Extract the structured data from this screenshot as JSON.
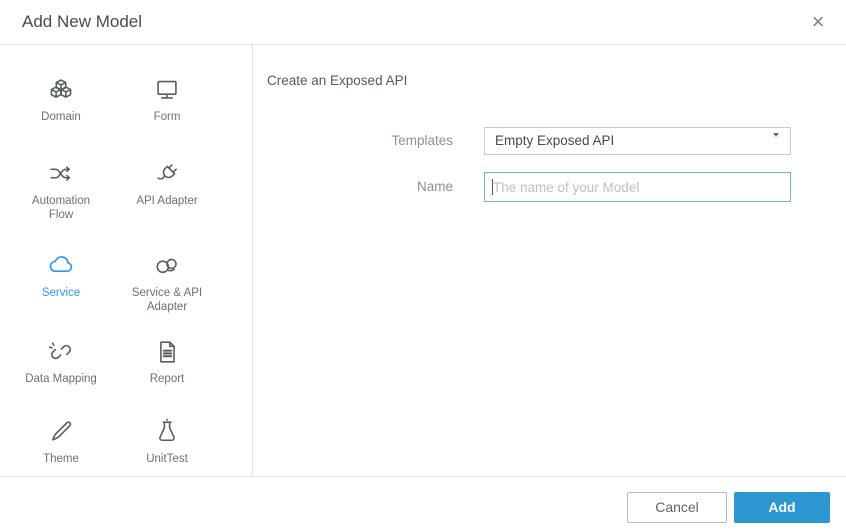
{
  "dialog": {
    "title": "Add New Model",
    "close_glyph": "×"
  },
  "sidebar": {
    "items": [
      {
        "label": "Domain",
        "icon": "cubes-icon",
        "selected": false
      },
      {
        "label": "Form",
        "icon": "monitor-icon",
        "selected": false
      },
      {
        "label": "Automation Flow",
        "icon": "shuffle-icon",
        "selected": false
      },
      {
        "label": "API Adapter",
        "icon": "plug-icon",
        "selected": false
      },
      {
        "label": "Service",
        "icon": "cloud-icon",
        "selected": true
      },
      {
        "label": "Service & API Adapter",
        "icon": "cloud-loop-icon",
        "selected": false
      },
      {
        "label": "Data Mapping",
        "icon": "broken-link-icon",
        "selected": false
      },
      {
        "label": "Report",
        "icon": "report-document-icon",
        "selected": false
      },
      {
        "label": "Theme",
        "icon": "paintbrush-icon",
        "selected": false
      },
      {
        "label": "UnitTest",
        "icon": "flask-icon",
        "selected": false
      }
    ]
  },
  "main": {
    "heading": "Create an Exposed API",
    "templates": {
      "label": "Templates",
      "value": "Empty Exposed API"
    },
    "name": {
      "label": "Name",
      "value": "",
      "placeholder": "The name of your Model"
    }
  },
  "footer": {
    "cancel_label": "Cancel",
    "add_label": "Add"
  },
  "colors": {
    "accent_blue": "#2d97d2",
    "selected_blue": "#2f97f8",
    "focus_border": "#70b0e0",
    "icon_gray": "#595e63"
  }
}
